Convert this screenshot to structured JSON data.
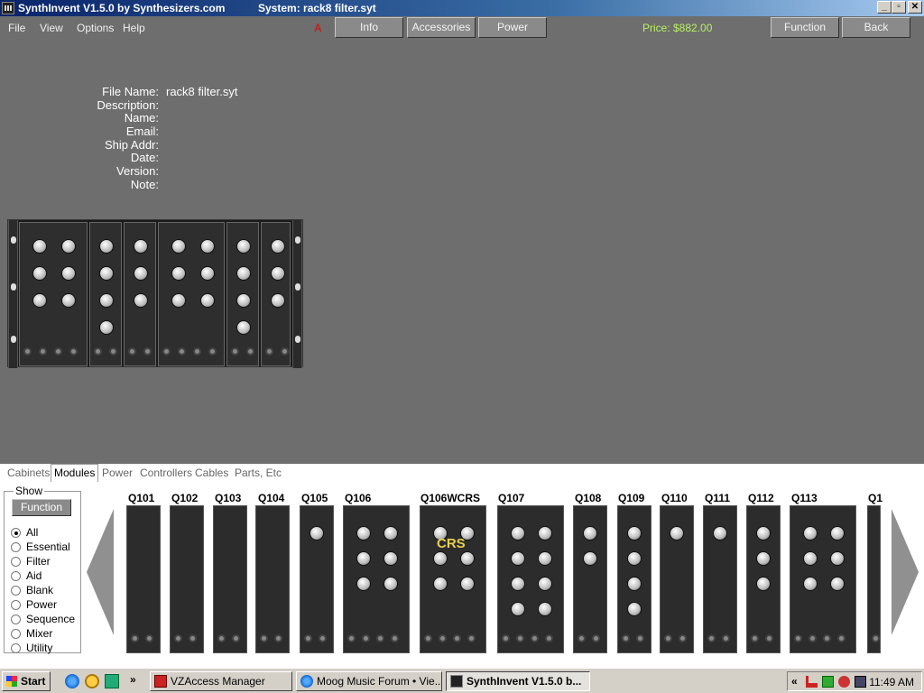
{
  "window": {
    "title": "SynthInvent V1.5.0 by Synthesizers.com",
    "system_label": "System: rack8 filter.syt",
    "controls": [
      "_",
      "▫",
      "✕"
    ]
  },
  "menu": [
    "File",
    "View",
    "Options",
    "Help"
  ],
  "toolbar": {
    "indicator": "A",
    "info": "Info",
    "accessories": "Accessories",
    "power": "Power",
    "price": "Price: $882.00",
    "function": "Function",
    "back": "Back"
  },
  "info": {
    "fields": [
      {
        "label": "File Name:",
        "value": "rack8 filter.syt"
      },
      {
        "label": "Description:",
        "value": ""
      },
      {
        "label": "Name:",
        "value": ""
      },
      {
        "label": "Email:",
        "value": ""
      },
      {
        "label": "Ship Addr:",
        "value": ""
      },
      {
        "label": "Date:",
        "value": ""
      },
      {
        "label": "Version:",
        "value": ""
      },
      {
        "label": "Note:",
        "value": ""
      }
    ]
  },
  "tabs": [
    "Cabinets",
    "Modules",
    "Power",
    "Controllers",
    "Cables",
    "Parts, Etc"
  ],
  "active_tab": "Modules",
  "show": {
    "legend": "Show",
    "function_button": "Function",
    "options": [
      "All",
      "Essential",
      "Filter",
      "Aid",
      "Blank",
      "Power",
      "Sequence",
      "Mixer",
      "Utility"
    ],
    "selected": "All"
  },
  "modules": [
    "Q101",
    "Q102",
    "Q103",
    "Q104",
    "Q105",
    "Q106",
    "Q106WCRS",
    "Q107",
    "Q108",
    "Q109",
    "Q110",
    "Q111",
    "Q112",
    "Q113",
    "Q1"
  ],
  "module_overlay": "CRS",
  "taskbar": {
    "start": "Start",
    "more": "»",
    "tasks": [
      "VZAccess Manager",
      "Moog Music Forum • Vie...",
      "SynthInvent V1.5.0 b..."
    ],
    "tray_expand": "«",
    "clock": "11:49 AM"
  }
}
